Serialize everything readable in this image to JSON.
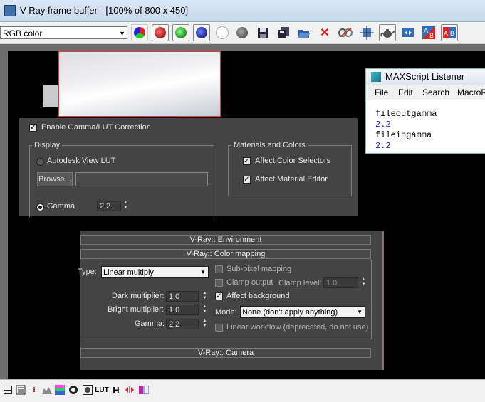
{
  "window": {
    "title": "V-Ray frame buffer - [100% of 800 x 450]"
  },
  "toolbar": {
    "channel_select": "RGB color",
    "icons": [
      "rgb-channels-icon",
      "red-channel-icon",
      "green-channel-icon",
      "blue-channel-icon",
      "alpha-channel-icon",
      "monochrome-icon",
      "save-icon",
      "save-multiple-icon",
      "load-icon",
      "clear-icon",
      "track-mouse-icon",
      "region-render-icon",
      "render-last-icon",
      "link-to-vfb-icon",
      "compare-ab-horizontal-icon",
      "compare-ab-vertical-icon"
    ]
  },
  "gamma_panel": {
    "enable_label": "Enable Gamma/LUT Correction",
    "display_group": "Display",
    "autodesk_lut_label": "Autodesk View LUT",
    "browse_label": "Browse...",
    "browse_path": "",
    "gamma_label": "Gamma",
    "gamma_value": "2.2",
    "materials_group": "Materials and Colors",
    "affect_selectors_label": "Affect Color Selectors",
    "affect_editor_label": "Affect Material Editor"
  },
  "listener": {
    "title": "MAXScript Listener",
    "menu": [
      "File",
      "Edit",
      "Search",
      "MacroR"
    ],
    "lines": [
      {
        "text": "fileoutgamma",
        "color": "#000000"
      },
      {
        "text": "2.2",
        "color": "#1f1fcc"
      },
      {
        "text": "fileingamma",
        "color": "#000000"
      },
      {
        "text": "2.2",
        "color": "#1f1fcc"
      }
    ]
  },
  "vray": {
    "environment_rollout": "V-Ray:: Environment",
    "colormap_rollout": "V-Ray:: Color mapping",
    "camera_rollout": "V-Ray:: Camera",
    "type_label": "Type:",
    "type_value": "Linear multiply",
    "dark_label": "Dark multiplier:",
    "dark_value": "1.0",
    "bright_label": "Bright multiplier:",
    "bright_value": "1.0",
    "gamma_label": "Gamma:",
    "gamma_value": "2.2",
    "subpixel_label": "Sub-pixel mapping",
    "clamp_label": "Clamp output",
    "clamp_level_label": "Clamp level:",
    "clamp_level_value": "1.0",
    "affect_bg_label": "Affect background",
    "mode_label": "Mode:",
    "mode_value": "None (don't apply anything)",
    "linear_workflow_label": "Linear workflow (deprecated, do not use)"
  },
  "statusbar": {
    "icons": [
      "history-icon",
      "pixel-info-icon",
      "info-icon",
      "levels-icon",
      "curves-icon",
      "color-correction-icon",
      "lens-effects-icon",
      "stamp-icon",
      "lut-icon",
      "histogram-icon",
      "flip-icon",
      "icc-icon"
    ],
    "lut_text": "LUT",
    "info_text": "i",
    "histogram_text": "H"
  },
  "colors": {
    "accent_red": "#e23a3a",
    "panel_bg": "#444444",
    "listener_value": "#1f1fcc"
  }
}
